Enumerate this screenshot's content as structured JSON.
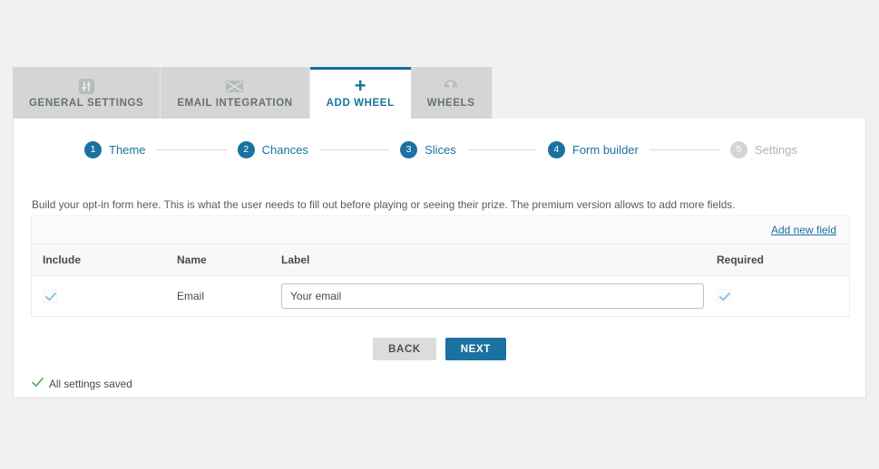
{
  "colors": {
    "accent": "#1a72a0",
    "accent_dark": "#126e9c",
    "page_bg": "#f1f1f1",
    "tab_bg": "#d4d6d6",
    "tab_text": "#6b6f72",
    "inactive_step": "#d4d4d4",
    "success_green": "#4caf50",
    "checkbox_blue": "#8ec9e4"
  },
  "tabs": [
    {
      "label": "GENERAL SETTINGS",
      "icon": "sliders-icon",
      "active": false
    },
    {
      "label": "EMAIL INTEGRATION",
      "icon": "envelope-icon",
      "active": false
    },
    {
      "label": "ADD WHEEL",
      "icon": "plus-icon",
      "active": true
    },
    {
      "label": "WHEELS",
      "icon": "wheel-icon",
      "active": false
    }
  ],
  "stepper": {
    "steps": [
      {
        "number": "1",
        "label": "Theme",
        "active": true
      },
      {
        "number": "2",
        "label": "Chances",
        "active": true
      },
      {
        "number": "3",
        "label": "Slices",
        "active": true
      },
      {
        "number": "4",
        "label": "Form builder",
        "active": true
      },
      {
        "number": "5",
        "label": "Settings",
        "active": false
      }
    ]
  },
  "main": {
    "description": "Build your opt-in form here. This is what the user needs to fill out before playing or seeing their prize. The premium version allows to add more fields.",
    "add_new_field_label": "Add new field",
    "table": {
      "headers": [
        "Include",
        "Name",
        "Label",
        "Required"
      ],
      "rows": [
        {
          "include_checked": true,
          "name": "Email",
          "label_value": "Your email",
          "label_placeholder": "Your email",
          "required_checked": true
        }
      ]
    },
    "buttons": {
      "back_label": "BACK",
      "next_label": "NEXT"
    },
    "status": {
      "text": "All settings saved",
      "icon": "check-icon"
    }
  }
}
